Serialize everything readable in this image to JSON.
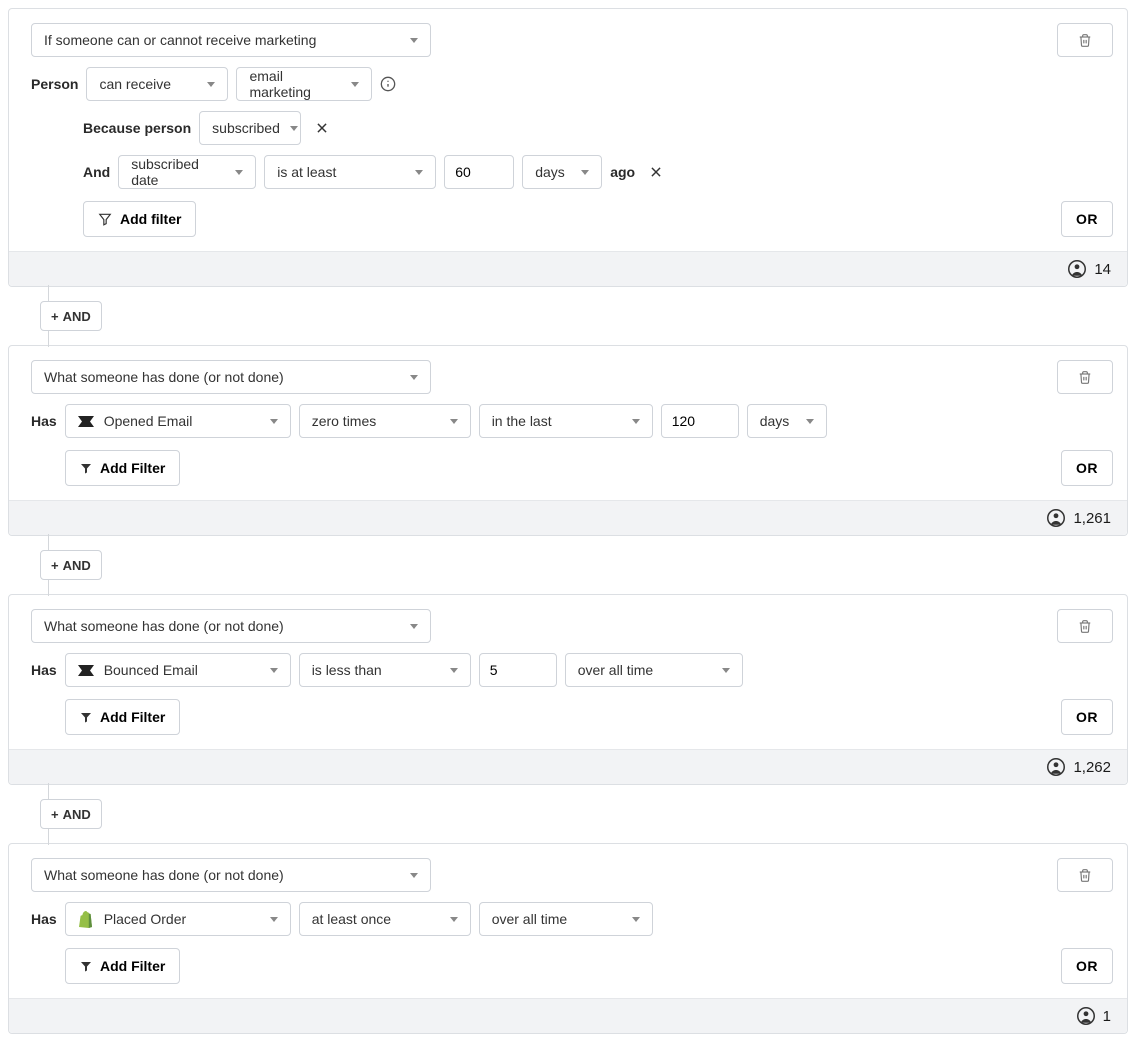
{
  "common": {
    "and_label": "AND",
    "or_label": "OR",
    "add_filter_label": "Add Filter",
    "add_filter_label_alt": "Add filter"
  },
  "block1": {
    "condition_type": "If someone can or cannot receive marketing",
    "person_label": "Person",
    "can_receive": "can receive",
    "marketing_type": "email marketing",
    "because_label": "Because person",
    "subscribed": "subscribed",
    "and_label_inner": "And",
    "date_field": "subscribed date",
    "operator": "is at least",
    "value": "60",
    "unit": "days",
    "ago_label": "ago",
    "count": "14"
  },
  "block2": {
    "condition_type": "What someone has done (or not done)",
    "has_label": "Has",
    "metric": "Opened Email",
    "freq": "zero times",
    "timeframe": "in the last",
    "value": "120",
    "unit": "days",
    "count": "1,261"
  },
  "block3": {
    "condition_type": "What someone has done (or not done)",
    "has_label": "Has",
    "metric": "Bounced Email",
    "freq": "is less than",
    "value": "5",
    "timeframe": "over all time",
    "count": "1,262"
  },
  "block4": {
    "condition_type": "What someone has done (or not done)",
    "has_label": "Has",
    "metric": "Placed Order",
    "freq": "at least once",
    "timeframe": "over all time",
    "count": "1"
  }
}
